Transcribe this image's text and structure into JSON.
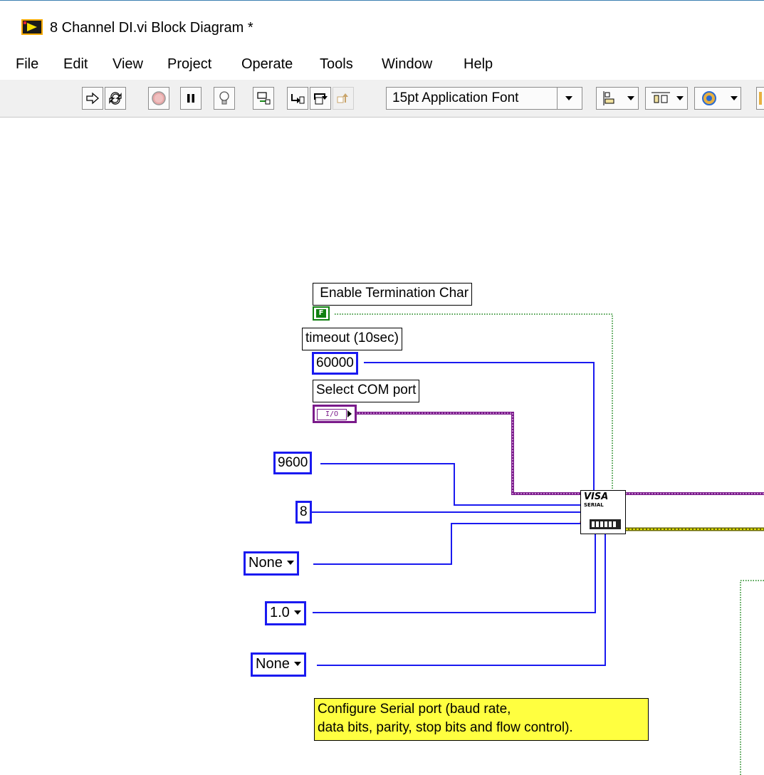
{
  "window": {
    "title": "8 Channel DI.vi Block Diagram *"
  },
  "menu": {
    "items": [
      "File",
      "Edit",
      "View",
      "Project",
      "Operate",
      "Tools",
      "Window",
      "Help"
    ]
  },
  "toolbar": {
    "font_select": "15pt Application Font",
    "buttons": [
      "run-arrow-icon",
      "run-continuous-icon",
      "abort-icon",
      "pause-icon",
      "highlight-execution-icon",
      "retain-wire-values-icon",
      "step-into-icon",
      "step-over-icon",
      "step-out-icon"
    ]
  },
  "diagram": {
    "labels": {
      "enable_term_char": "Enable Termination Char",
      "timeout": "timeout (10sec)",
      "select_com": "Select COM port"
    },
    "constants": {
      "bool_value": "F",
      "timeout_value": "60000",
      "io_value": "I/O",
      "baud_rate": "9600",
      "data_bits": "8",
      "parity": "None",
      "stop_bits": "1.0",
      "flow_control": "None"
    },
    "node": {
      "line1": "VISA",
      "line2": "SERIAL"
    },
    "comment": {
      "line1": "Configure Serial port (baud rate,",
      "line2": "data bits, parity, stop bits and flow control)."
    }
  },
  "colors": {
    "numeric_wire": "#1a1af0",
    "boolean_wire": "#108010",
    "visa_wire": "#7a1a8a",
    "error_wire": "#c8c800",
    "comment_bg": "#ffff40"
  }
}
